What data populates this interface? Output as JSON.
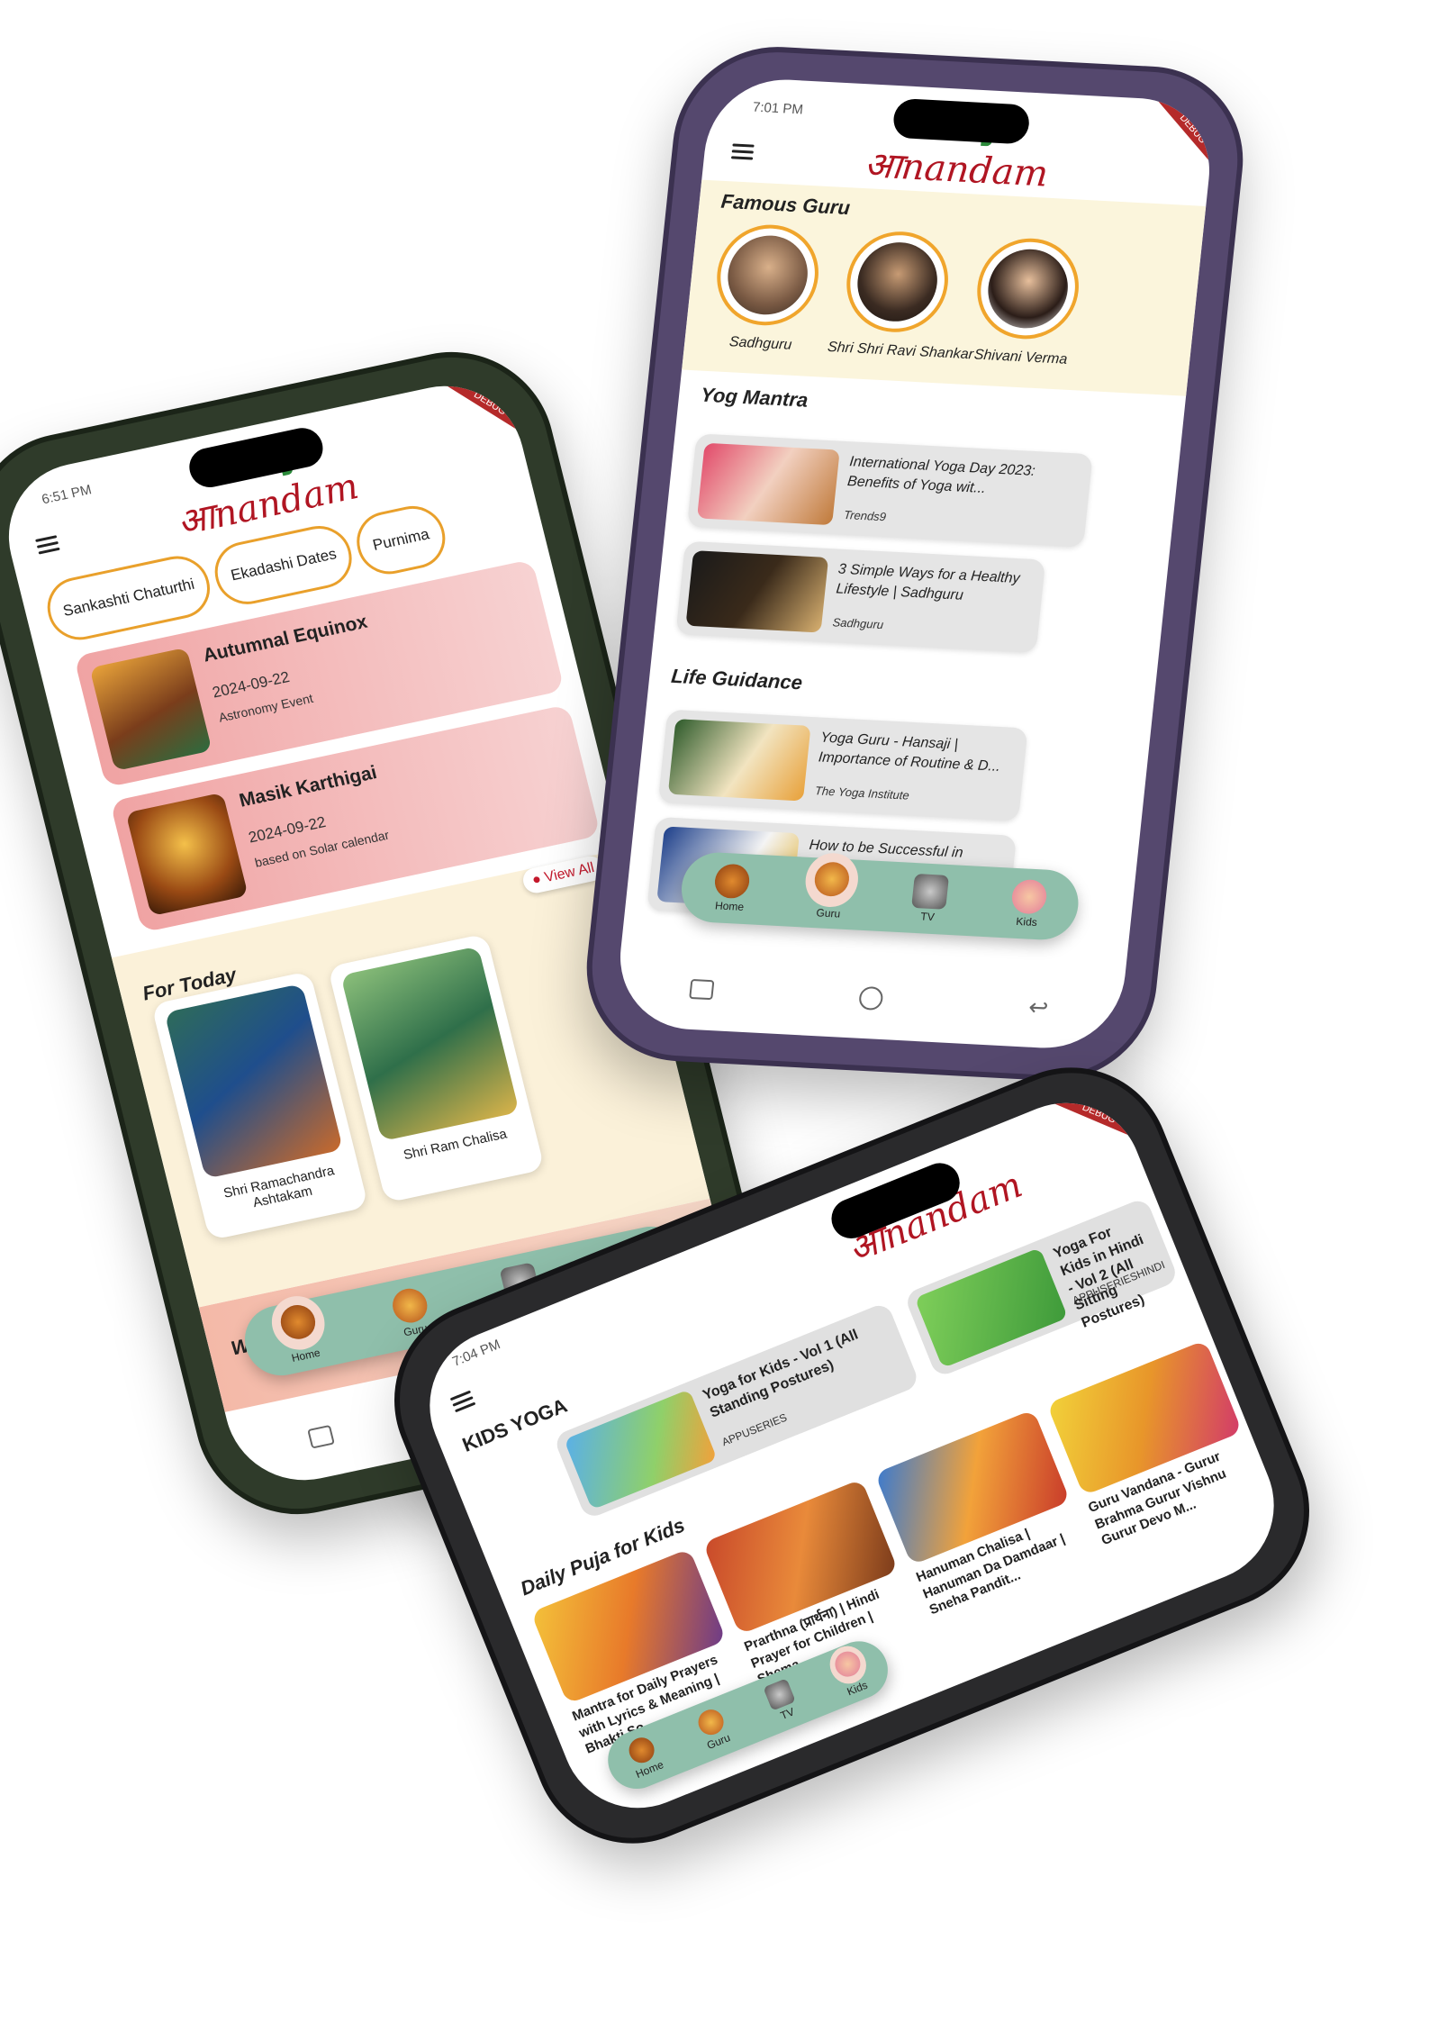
{
  "app": {
    "logo_text": "आnandam",
    "debug_label": "DEBUG"
  },
  "colors": {
    "brand_red": "#b01522",
    "nav_green": "#8fbfab",
    "chip_border": "#e9a02b",
    "event_pink": "#f0a3a3"
  },
  "nav": {
    "home": "Home",
    "guru": "Guru",
    "tv": "TV",
    "kids": "Kids"
  },
  "phone1": {
    "time": "6:51 PM",
    "chips": [
      "Sankashti Chaturthi",
      "Ekadashi Dates",
      "Purnima"
    ],
    "events": [
      {
        "title": "Autumnal Equinox",
        "date": "2024-09-22",
        "sub": "Astronomy Event"
      },
      {
        "title": "Masik Karthigai",
        "date": "2024-09-22",
        "sub": "based on Solar calendar"
      }
    ],
    "view_all": "View All",
    "for_today_title": "For Today",
    "for_today": [
      {
        "caption": "Shri Ramachandra Ashtakam"
      },
      {
        "caption": "Shri Ram Chalisa"
      }
    ],
    "wallpapers_title": "Wallpapers For You",
    "active_tab": "Home"
  },
  "phone2": {
    "time": "7:01 PM",
    "famous_guru_title": "Famous Guru",
    "gurus": [
      {
        "name": "Sadhguru"
      },
      {
        "name": "Shri Shri Ravi Shankar"
      },
      {
        "name": "Shivani Verma"
      }
    ],
    "yog_mantra_title": "Yog Mantra",
    "yog_videos": [
      {
        "title": "International Yoga Day 2023: Benefits of Yoga wit...",
        "source": "Trends9"
      },
      {
        "title": "3 Simple Ways for a Healthy Lifestyle | Sadhguru",
        "source": "Sadhguru"
      }
    ],
    "life_guidance_title": "Life Guidance",
    "life_videos": [
      {
        "title": "Yoga Guru - Hansaji | Importance of Routine & D...",
        "source": "The Yoga Institute"
      },
      {
        "title": "How to be Successful in",
        "source": ""
      }
    ],
    "active_tab": "Guru"
  },
  "phone3": {
    "time": "7:04 PM",
    "kids_yoga_title": "KIDS YOGA",
    "kids_yoga": [
      {
        "title": "Yoga for Kids - Vol 1 (All Standing Postures)",
        "source": "APPUSERIES"
      },
      {
        "title": "Yoga For Kids in Hindi - Vol 2 (All Sitting Postures)",
        "source": "APPUSERIESHINDI"
      }
    ],
    "daily_puja_title": "Daily Puja for Kids",
    "puja": [
      {
        "caption": "Mantra for Daily Prayers with Lyrics & Meaning | Bhakti So..."
      },
      {
        "caption": "Prarthna (प्रार्थना) | Hindi Prayer for Children | Shema..."
      },
      {
        "caption": "Hanuman Chalisa | Hanuman Da Damdaar | Sneha Pandit..."
      },
      {
        "caption": "Guru Vandana - Gurur Brahma Gurur Vishnu Gurur Devo M..."
      }
    ],
    "active_tab": "Kids"
  }
}
